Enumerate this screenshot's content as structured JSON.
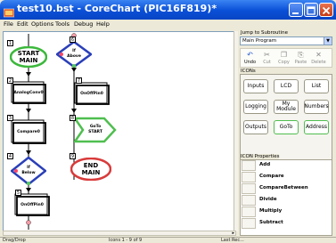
{
  "window": {
    "title": "test10.bst - CoreChart (PIC16F819)*",
    "app_icon": "corechart-app-icon"
  },
  "menu": [
    "File",
    "Edit",
    "Options",
    "Tools",
    "Debug",
    "Help"
  ],
  "flowchart": {
    "nodes": [
      {
        "num": "1",
        "label": "START\nMAIN",
        "shape": "start"
      },
      {
        "num": "2",
        "label": "AnalogConv0",
        "shape": "box"
      },
      {
        "num": "3",
        "label": "Compare0",
        "shape": "box"
      },
      {
        "num": "4",
        "label": "If\nBelow",
        "shape": "diamond"
      },
      {
        "num": "5",
        "label": "OnOffPin0",
        "shape": "box"
      },
      {
        "num": "6",
        "label": "If\nAbove",
        "shape": "diamond"
      },
      {
        "num": "7",
        "label": "OnOffPin0",
        "shape": "box"
      },
      {
        "num": "8",
        "label": "GoTo\nSTART",
        "shape": "goto"
      },
      {
        "num": "9",
        "label": "END\nMAIN",
        "shape": "end"
      }
    ]
  },
  "status": {
    "left": "Drag/Drop",
    "middle": "Icons 1 - 9 of 9",
    "right": "Last Rec..."
  },
  "panel": {
    "jump_label": "Jump to Subroutine",
    "jump_value": "Main Program",
    "toolbar": [
      {
        "label": "Undo",
        "icon": "undo-icon",
        "glyph": "↶"
      },
      {
        "label": "Cut",
        "icon": "cut-icon",
        "glyph": "✂"
      },
      {
        "label": "Copy",
        "icon": "copy-icon",
        "glyph": "❐"
      },
      {
        "label": "Paste",
        "icon": "paste-icon",
        "glyph": "⎘"
      },
      {
        "label": "Delete",
        "icon": "delete-icon",
        "glyph": "✕"
      }
    ],
    "icons_label": "ICONs",
    "icons": [
      "Inputs",
      "LCD",
      "List",
      "Logging",
      "My\nModule",
      "Numbers",
      "Outputs",
      "GoTo",
      "Address"
    ],
    "props_label": "ICON Properties",
    "properties": [
      "Add",
      "Compare",
      "CompareBetween",
      "Divide",
      "Multiply",
      "Subtract"
    ]
  },
  "colors": {
    "title_blue": "#0a4fd6",
    "start_green": "#3cb83c",
    "end_red": "#d93b3b",
    "diamond_blue": "#2a3fb8",
    "goto_green": "#4fbe4f"
  }
}
